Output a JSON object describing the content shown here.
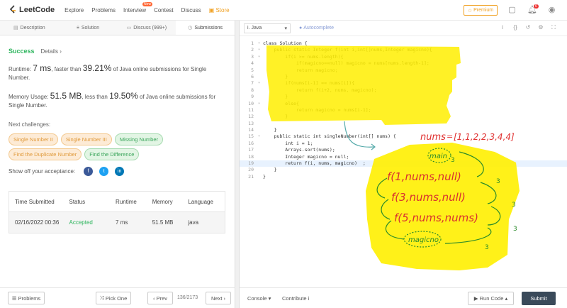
{
  "topbar": {
    "logo": "LeetCode",
    "nav": [
      "Explore",
      "Problems",
      "Interview",
      "Contest",
      "Discuss"
    ],
    "new_badge": "New",
    "store": "Store",
    "premium": "Premium",
    "notif_count": "6"
  },
  "tabs": [
    "Description",
    "Solution",
    "Discuss (999+)",
    "Submissions"
  ],
  "result": {
    "status": "Success",
    "details": "Details",
    "runtime_prefix": "Runtime: ",
    "runtime_value": "7 ms",
    "runtime_mid": ", faster than ",
    "runtime_pct": "39.21%",
    "runtime_suffix": " of Java online submissions for Single Number.",
    "memory_prefix": "Memory Usage: ",
    "memory_value": "51.5 MB",
    "memory_mid": ", less than ",
    "memory_pct": "19.50%",
    "memory_suffix": " of Java online submissions for Single Number.",
    "next_label": "Next challenges:",
    "challenges": [
      {
        "label": "Single Number II",
        "color": "orange"
      },
      {
        "label": "Single Number III",
        "color": "orange"
      },
      {
        "label": "Missing Number",
        "color": "green"
      },
      {
        "label": "Find the Duplicate Number",
        "color": "orange"
      },
      {
        "label": "Find the Difference",
        "color": "green"
      }
    ],
    "share_label": "Show off your acceptance:"
  },
  "table": {
    "headers": [
      "Time Submitted",
      "Status",
      "Runtime",
      "Memory",
      "Language"
    ],
    "row": [
      "02/16/2022 00:36",
      "Accepted",
      "7 ms",
      "51.5 MB",
      "java"
    ]
  },
  "bottom_left": {
    "problems": "Problems",
    "pick_one": "Pick One",
    "prev": "Prev",
    "page": "136/2173",
    "next": "Next"
  },
  "editor": {
    "language": "Java",
    "autocomplete": "Autocomplete",
    "lines": [
      "class Solution {",
      "    public static Integer f(int i,int[]nums,Integer magicno){",
      "        if(i >= nums.length){",
      "            if(magicno==null) magicno = nums[nums.length-1];",
      "            return magicno;",
      "        }",
      "        if(nums[i-1] == nums[i]){",
      "            return f(i+2, nums, magicno);",
      "        }",
      "        else{",
      "            return magicno = nums[i-1];",
      "        }",
      "",
      "    }",
      "    public static int singleNumber(int[] nums) {",
      "        int i = 1;",
      "        Arrays.sort(nums);",
      "        Integer magicno = null;",
      "        return f(i, nums, magicno)  ;",
      "    }",
      "}"
    ]
  },
  "annotation": {
    "nums": "nums",
    "array": "[1,1,2,2,3,4,4]",
    "main": "main",
    "call1": "f(1,nums,null)",
    "call2": "f(3,nums,null)",
    "call3": "f(5,nums,nums)",
    "magicno": "magicno",
    "arrow_num": "3"
  },
  "bottom_right": {
    "console": "Console",
    "contribute": "Contribute",
    "run": "Run Code",
    "submit": "Submit"
  }
}
